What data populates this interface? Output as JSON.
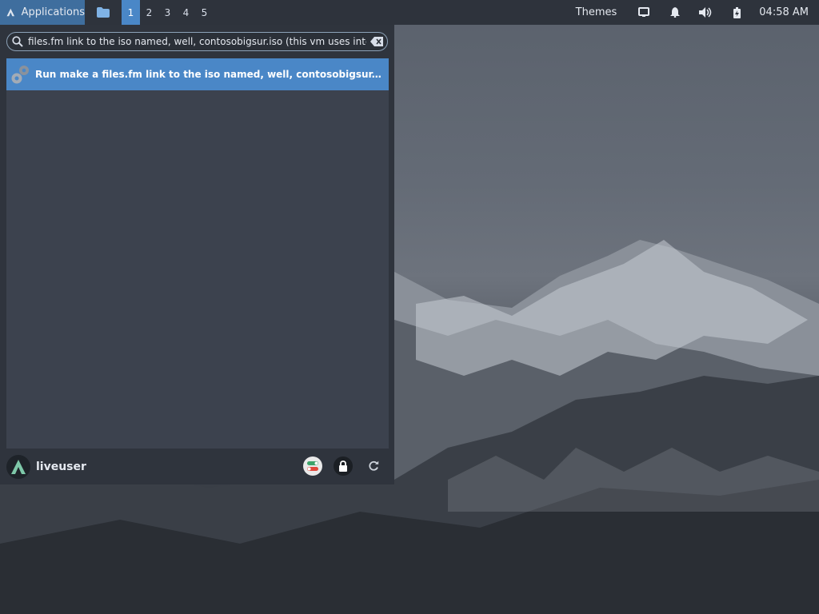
{
  "panel": {
    "applications_label": "Applications",
    "workspaces": [
      "1",
      "2",
      "3",
      "4",
      "5"
    ],
    "active_workspace": "1",
    "themes_label": "Themes",
    "clock": "04:58 AM"
  },
  "menu": {
    "search_value": "files.fm link to the iso named, well, contosobigsur.iso (this vm uses intel btw)",
    "result_label": "Run make a files.fm link to the iso named, well, contosobigsur.iso (this v...",
    "username": "liveuser"
  },
  "colors": {
    "panel_bg": "#2e333c",
    "accent": "#4a87c7",
    "menu_bg": "#2f343d",
    "results_bg": "#3c424e"
  }
}
